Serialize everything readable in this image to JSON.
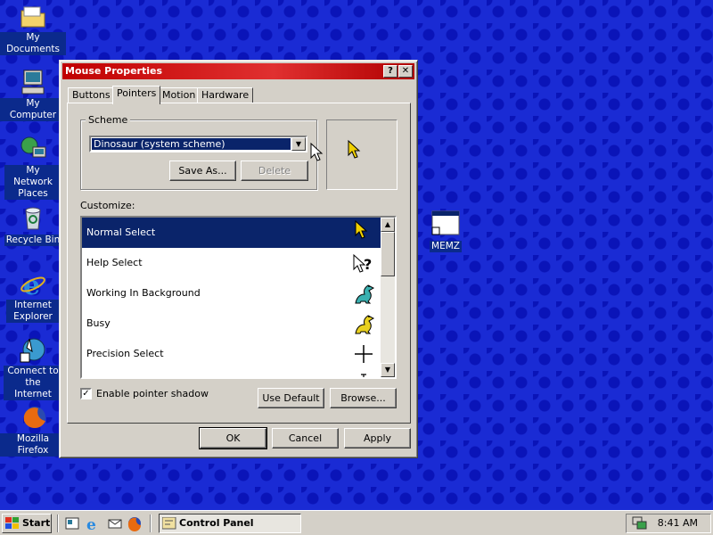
{
  "desktop": {
    "icons": [
      {
        "label": "My Documents"
      },
      {
        "label": "My Computer"
      },
      {
        "label": "My Network Places"
      },
      {
        "label": "Recycle Bin"
      },
      {
        "label": "Internet Explorer"
      },
      {
        "label": "Connect to the Internet"
      },
      {
        "label": "Mozilla Firefox"
      },
      {
        "label": "MEMZ"
      }
    ]
  },
  "dialog": {
    "title": "Mouse Properties",
    "help_btn": "?",
    "close_btn": "✕",
    "tabs": [
      "Buttons",
      "Pointers",
      "Motion",
      "Hardware"
    ],
    "active_tab": "Pointers",
    "scheme_label": "Scheme",
    "scheme_value": "Dinosaur (system scheme)",
    "save_as": "Save As...",
    "delete": "Delete",
    "customize_label": "Customize:",
    "pointers": [
      {
        "name": "Normal Select",
        "icon": "arrow-icon",
        "selected": true
      },
      {
        "name": "Help Select",
        "icon": "help-arrow-icon"
      },
      {
        "name": "Working In Background",
        "icon": "dinosaur-icon"
      },
      {
        "name": "Busy",
        "icon": "dinosaur-icon"
      },
      {
        "name": "Precision Select",
        "icon": "crosshair-icon"
      }
    ],
    "shadow_label": "Enable pointer shadow",
    "shadow_checked": true,
    "use_default": "Use Default",
    "browse": "Browse...",
    "ok": "OK",
    "cancel": "Cancel",
    "apply": "Apply"
  },
  "taskbar": {
    "start": "Start",
    "task": "Control Panel",
    "clock": "8:41 AM"
  },
  "colors": {
    "desktop": "#1a2bd4",
    "title_bar": "#c00000",
    "selection": "#0a246a",
    "face": "#d4d0c8"
  }
}
